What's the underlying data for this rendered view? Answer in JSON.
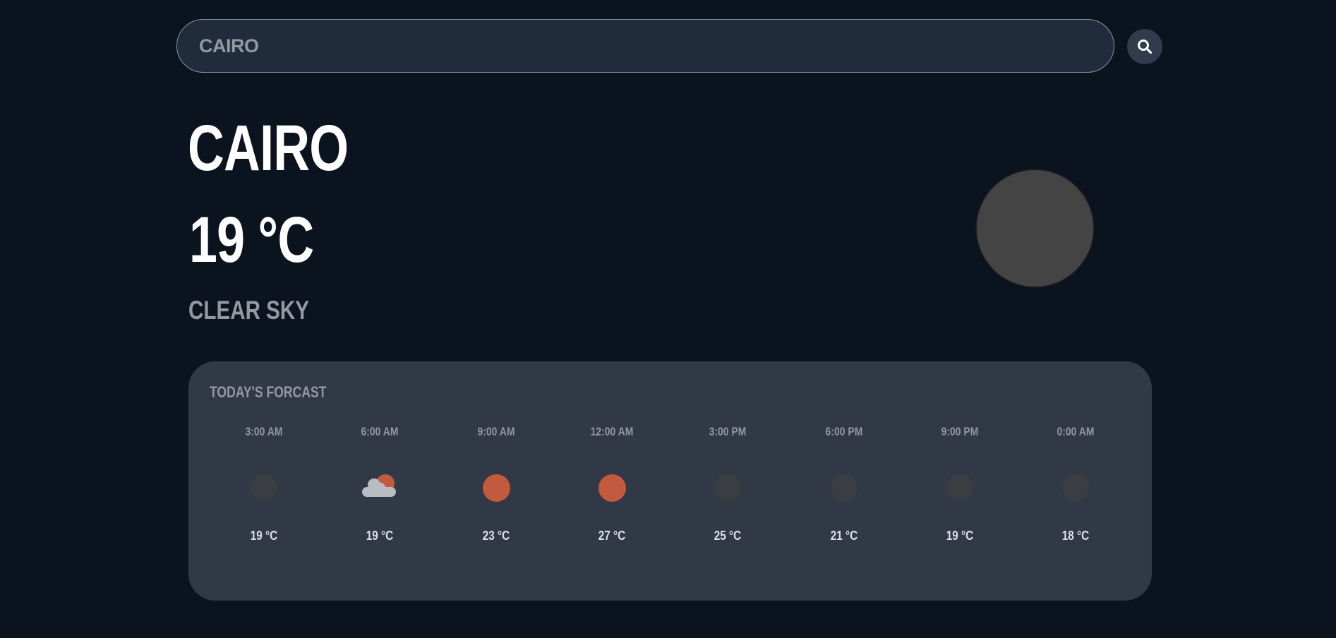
{
  "search": {
    "value": "CAIRO",
    "placeholder": ""
  },
  "current": {
    "city": "CAIRO",
    "temperature": "19 °C",
    "condition": "CLEAR SKY",
    "icon": "moon-icon"
  },
  "forecast": {
    "title": "TODAY'S FORCAST",
    "items": [
      {
        "time": "3:00 AM",
        "temp": "19 °C",
        "icon": "moon-icon"
      },
      {
        "time": "6:00 AM",
        "temp": "19 °C",
        "icon": "partly-cloudy-icon"
      },
      {
        "time": "9:00 AM",
        "temp": "23 °C",
        "icon": "sun-icon"
      },
      {
        "time": "12:00 AM",
        "temp": "27 °C",
        "icon": "sun-icon"
      },
      {
        "time": "3:00 PM",
        "temp": "25 °C",
        "icon": "moon-icon"
      },
      {
        "time": "6:00 PM",
        "temp": "21 °C",
        "icon": "moon-icon"
      },
      {
        "time": "9:00 PM",
        "temp": "19 °C",
        "icon": "moon-icon"
      },
      {
        "time": "0:00 AM",
        "temp": "18 °C",
        "icon": "moon-icon"
      }
    ]
  },
  "colors": {
    "background": "#0b131e",
    "search_bg": "#202b3b",
    "panel_bg": "#313846",
    "sun": "#c25a40",
    "moon": "#3a3d42",
    "muted_text": "#9399a2"
  }
}
